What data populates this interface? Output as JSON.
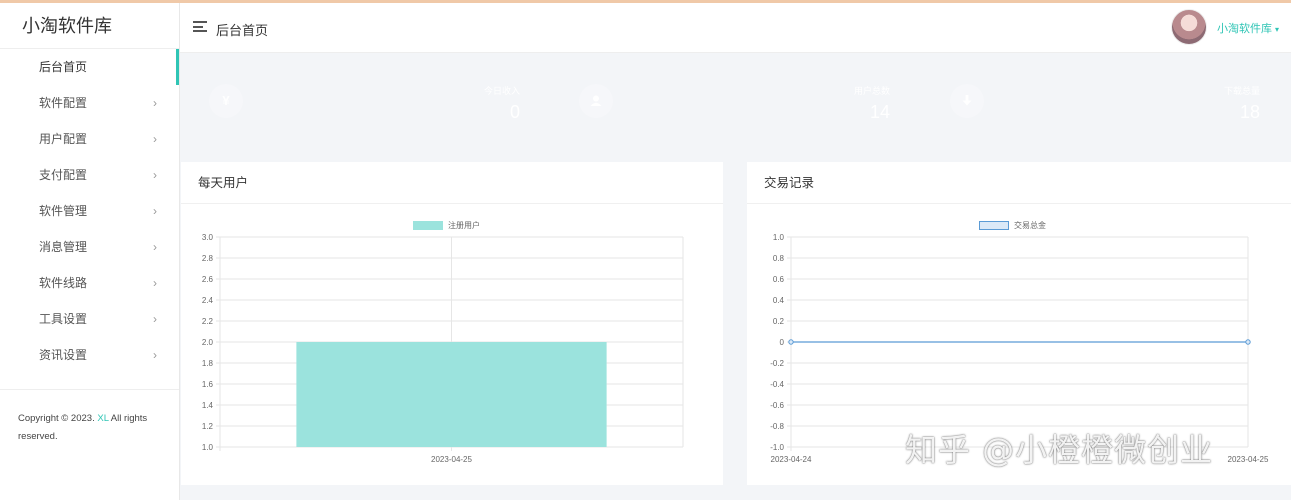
{
  "app": {
    "brand": "小淘软件库"
  },
  "sidebar": {
    "items": [
      {
        "label": "后台首页",
        "active": true
      },
      {
        "label": "软件配置",
        "chevron": "›"
      },
      {
        "label": "用户配置",
        "chevron": "›"
      },
      {
        "label": "支付配置",
        "chevron": "›"
      },
      {
        "label": "软件管理",
        "chevron": "›"
      },
      {
        "label": "消息管理",
        "chevron": "›"
      },
      {
        "label": "软件线路",
        "chevron": "›"
      },
      {
        "label": "工具设置",
        "chevron": "›"
      },
      {
        "label": "资讯设置",
        "chevron": "›"
      }
    ],
    "copyright": {
      "prefix": "Copyright © 2023. ",
      "link": "XL",
      "suffix": " All rights reserved."
    }
  },
  "header": {
    "breadcrumb": "后台首页",
    "user_name": "小淘软件库",
    "caret": "▾"
  },
  "stats": [
    {
      "label": "今日收入",
      "value": "0",
      "icon": "yen-icon",
      "glyph": "¥",
      "color": "#35cbbd"
    },
    {
      "label": "用户总数",
      "value": "14",
      "icon": "user-icon",
      "glyph": "",
      "color": "#f6696a"
    },
    {
      "label": "下载总量",
      "value": "18",
      "icon": "download-icon",
      "glyph": "",
      "color": "#1fc37a"
    }
  ],
  "panels": {
    "daily_users_title": "每天用户",
    "transactions_title": "交易记录"
  },
  "chart_data": [
    {
      "type": "bar",
      "title": "每天用户",
      "categories": [
        "2023-04-25"
      ],
      "series": [
        {
          "name": "注册用户",
          "values": [
            2
          ],
          "color": "#9be3dd"
        }
      ],
      "ylim": [
        1.0,
        3.0
      ],
      "yticks": [
        "1.0",
        "1.2",
        "1.4",
        "1.6",
        "1.8",
        "2.0",
        "2.2",
        "2.4",
        "2.6",
        "2.8",
        "3.0"
      ],
      "grid": true,
      "legend": "top-center"
    },
    {
      "type": "line",
      "title": "交易记录",
      "categories": [
        "2023-04-24",
        "2023-04-25"
      ],
      "series": [
        {
          "name": "交易总金",
          "values": [
            0,
            0
          ],
          "color": "#5b9bd5"
        }
      ],
      "ylim": [
        -1.0,
        1.0
      ],
      "yticks": [
        "-1.0",
        "-0.8",
        "-0.6",
        "-0.4",
        "-0.2",
        "0",
        "0.2",
        "0.4",
        "0.6",
        "0.8",
        "1.0"
      ],
      "grid": true,
      "legend": "top-center"
    }
  ],
  "watermark": "知乎 @小橙橙微创业"
}
